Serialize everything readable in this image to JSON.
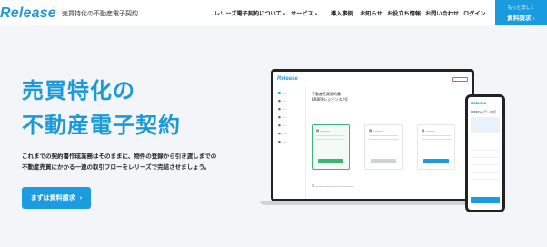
{
  "header": {
    "logo": "Release",
    "tagline": "売買特化の不動産電子契約",
    "nav": [
      {
        "label": "レリーズ電子契約について",
        "dropdown": true
      },
      {
        "label": "サービス",
        "dropdown": true
      },
      {
        "label": "導入事例",
        "dropdown": false
      },
      {
        "label": "お知らせ",
        "dropdown": false
      },
      {
        "label": "お役立ち情報",
        "dropdown": false
      },
      {
        "label": "お問い合わせ",
        "dropdown": false
      },
      {
        "label": "ログイン",
        "dropdown": false
      }
    ],
    "cta": {
      "small": "もっと詳しく",
      "big": "資料請求"
    }
  },
  "hero": {
    "title_line1": "売買特化の",
    "title_line2": "不動産電子契約",
    "desc_line1": "これまでの契約書作成業務はそのままに、物件の登録から引き渡しまでの",
    "desc_line2": "不動産売買にかかる一連の取引フローをレリーズで完結させましょう。",
    "button": "まずは資料請求",
    "button_arrow": "›"
  },
  "mockup": {
    "laptop_logo": "Release",
    "laptop_title1": "不動産売買契約書",
    "laptop_title2": "RRBRPレジデンス2号",
    "phone_logo": "Release",
    "phone_title": "RRBRPレジデンス2号"
  }
}
